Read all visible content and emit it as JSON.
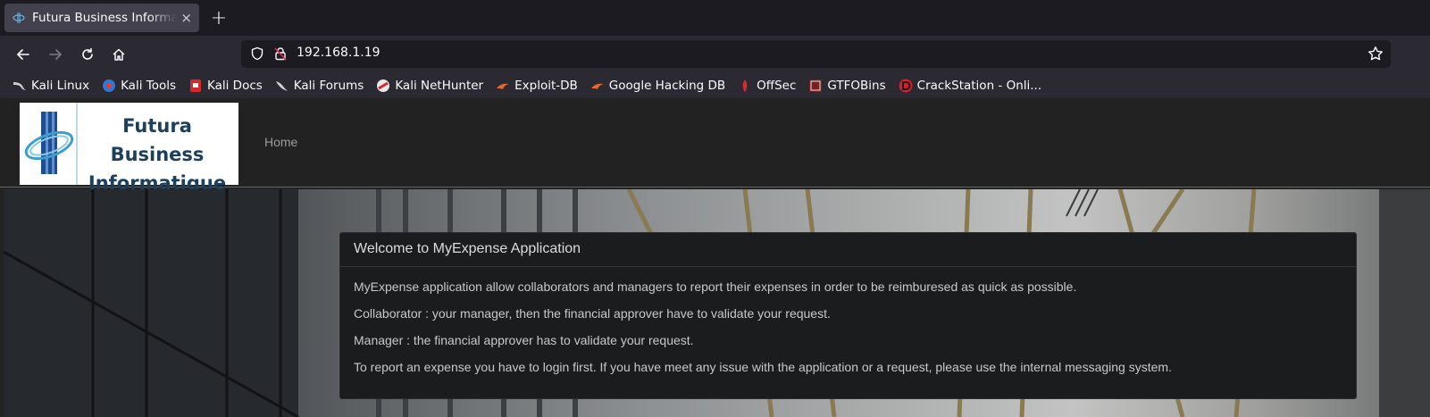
{
  "browser": {
    "tab": {
      "title": "Futura Business Informatique",
      "close": "×"
    },
    "new_tab": "+",
    "url": "192.168.1.19",
    "bookmarks": [
      {
        "label": "Kali Linux",
        "icon": "kali-dragon-icon"
      },
      {
        "label": "Kali Tools",
        "icon": "kali-tools-icon"
      },
      {
        "label": "Kali Docs",
        "icon": "kali-docs-icon"
      },
      {
        "label": "Kali Forums",
        "icon": "kali-forums-icon"
      },
      {
        "label": "Kali NetHunter",
        "icon": "nethunter-icon"
      },
      {
        "label": "Exploit-DB",
        "icon": "exploit-db-icon"
      },
      {
        "label": "Google Hacking DB",
        "icon": "ghdb-icon"
      },
      {
        "label": "OffSec",
        "icon": "offsec-icon"
      },
      {
        "label": "GTFOBins",
        "icon": "gtfobins-icon"
      },
      {
        "label": "CrackStation - Onli...",
        "icon": "crackstation-icon"
      }
    ]
  },
  "site": {
    "logo_line1": "Futura Business",
    "logo_line2": "Informatique",
    "nav_home": "Home"
  },
  "panel": {
    "title": "Welcome to MyExpense Application",
    "paragraphs": [
      "MyExpense application allow collaborators and managers to report their expenses in order to be reimburesed as quick as possible.",
      "Collaborator : your manager, then the financial approver have to validate your request.",
      "Manager : the financial approver has to validate your request.",
      "To report an expense you have to login first. If you have meet any issue with the application or a request, please use the internal messaging system."
    ]
  },
  "colors": {
    "tab_bg": "#42414d",
    "toolbar_bg": "#2b2a33",
    "url_bg": "#1c1b22",
    "header_bg": "#222222",
    "logo_text": "#1c3f5e",
    "panel_bg": "#1b1c1e"
  }
}
